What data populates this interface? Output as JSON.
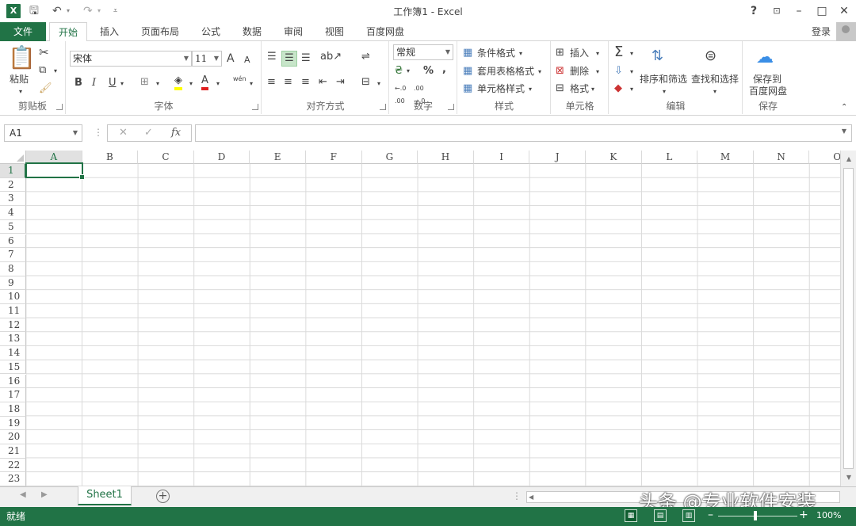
{
  "titlebar": {
    "title": "工作簿1 - Excel",
    "logo": "X",
    "qat": [
      "save-icon",
      "undo-icon",
      "redo-icon",
      "customize-icon"
    ],
    "help": "?",
    "restore_ribbon": "ribbon-display-icon",
    "minimize": "–",
    "maximize": "□",
    "close": "✕"
  },
  "tabs": {
    "file": "文件",
    "items": [
      "开始",
      "插入",
      "页面布局",
      "公式",
      "数据",
      "审阅",
      "视图",
      "百度网盘"
    ],
    "active_index": 0,
    "login": "登录"
  },
  "ribbon": {
    "clipboard": {
      "label": "剪贴板",
      "paste": "粘贴"
    },
    "font": {
      "label": "字体",
      "name": "宋体",
      "size": "11",
      "bold": "B",
      "italic": "I",
      "underline": "U",
      "font_color_glyph": "A",
      "grow": "A",
      "shrink": "A",
      "phonetic": "wén"
    },
    "alignment": {
      "label": "对齐方式"
    },
    "number": {
      "label": "数字",
      "format": "常规",
      "percent": "%",
      "comma": ",",
      "inc_decimal": "←.0 .00",
      "dec_decimal": ".00 →.0"
    },
    "styles": {
      "label": "样式",
      "conditional": "条件格式",
      "table": "套用表格格式",
      "cell_styles": "单元格样式"
    },
    "cells": {
      "label": "单元格",
      "insert": "插入",
      "delete": "删除",
      "format": "格式"
    },
    "editing": {
      "label": "编辑",
      "sort_filter": "排序和筛选",
      "find_select": "查找和选择",
      "sum": "Σ"
    },
    "save": {
      "label": "保存",
      "save_to_line1": "保存到",
      "save_to_line2": "百度网盘"
    }
  },
  "formula_bar": {
    "name_box": "A1",
    "cancel": "✕",
    "enter": "✓",
    "fx": "fx",
    "value": ""
  },
  "grid": {
    "columns": [
      "A",
      "B",
      "C",
      "D",
      "E",
      "F",
      "G",
      "H",
      "I",
      "J",
      "K",
      "L",
      "M",
      "N",
      "O"
    ],
    "rows": [
      "1",
      "2",
      "3",
      "4",
      "5",
      "6",
      "7",
      "8",
      "9",
      "10",
      "11",
      "12",
      "13",
      "14",
      "15",
      "16",
      "17",
      "18",
      "19",
      "20",
      "21",
      "22",
      "23"
    ],
    "active_cell": "A1"
  },
  "sheets": {
    "tabs": [
      "Sheet1"
    ],
    "active": "Sheet1",
    "add": "+"
  },
  "status": {
    "ready": "就绪",
    "zoom": "100%",
    "zoom_minus": "–",
    "zoom_plus": "+"
  },
  "watermark": "头条 @专业软件安装",
  "colors": {
    "accent": "#217346"
  }
}
